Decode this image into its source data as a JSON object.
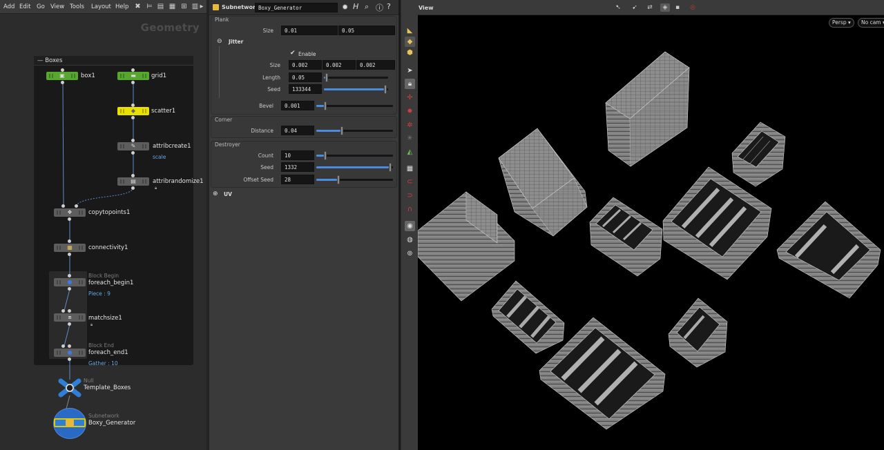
{
  "menubar": {
    "items": [
      "Add",
      "Edit",
      "Go",
      "View",
      "Tools",
      "Layout",
      "Help"
    ]
  },
  "network": {
    "context_label": "Geometry",
    "subnet_title": "Boxes",
    "nodes": {
      "box1": {
        "name": "box1"
      },
      "grid1": {
        "name": "grid1"
      },
      "scatter1": {
        "name": "scatter1"
      },
      "attribcreate1": {
        "name": "attribcreate1",
        "badge": "scale"
      },
      "attribrandomize1": {
        "name": "attribrandomize1"
      },
      "copytopoints1": {
        "name": "copytopoints1"
      },
      "connectivity1": {
        "name": "connectivity1"
      },
      "foreach_begin1": {
        "name": "foreach_begin1",
        "type": "Block Begin",
        "badge": "Piece : 9"
      },
      "matchsize1": {
        "name": "matchsize1"
      },
      "foreach_end1": {
        "name": "foreach_end1",
        "type": "Block End",
        "badge": "Gather : 10"
      },
      "template_boxes": {
        "name": "Template_Boxes",
        "type": "Null"
      },
      "boxy_generator": {
        "name": "Boxy_Generator",
        "type": "Subnetwork"
      }
    }
  },
  "params": {
    "header": {
      "node_type": "Subnetwork",
      "node_name": "Boxy_Generator"
    },
    "plank": {
      "title": "Plank",
      "size_label": "Size",
      "size": [
        "0.01",
        "0.05"
      ],
      "jitter": {
        "title": "Jitter",
        "enable_label": "Enable",
        "enable": true,
        "size_label": "Size",
        "size": [
          "0.002",
          "0.002",
          "0.002"
        ],
        "length_label": "Length",
        "length": "0.05",
        "length_frac": 0.02,
        "seed_label": "Seed",
        "seed": "133344",
        "seed_frac": 0.98
      },
      "bevel_label": "Bevel",
      "bevel": "0.001",
      "bevel_frac": 0.1
    },
    "corner": {
      "title": "Corner",
      "distance_label": "Distance",
      "distance": "0.04",
      "distance_frac": 0.33
    },
    "destroyer": {
      "title": "Destroyer",
      "count_label": "Count",
      "count": "10",
      "count_frac": 0.1,
      "seed_label": "Seed",
      "seed": "1332",
      "seed_frac": 0.98,
      "offset_seed_label": "Offset Seed",
      "offset_seed": "28",
      "offset_seed_frac": 0.28
    },
    "uv": {
      "title": "UV"
    }
  },
  "viewport": {
    "tab_label": "View",
    "camera_mode": "Persp ▾",
    "camera": "No cam ▾"
  },
  "colors": {
    "node_green": "#57a62f",
    "node_yellow": "#e8e000",
    "node_blue": "#2f7fd6",
    "slider_fill": "#4b8be0"
  }
}
